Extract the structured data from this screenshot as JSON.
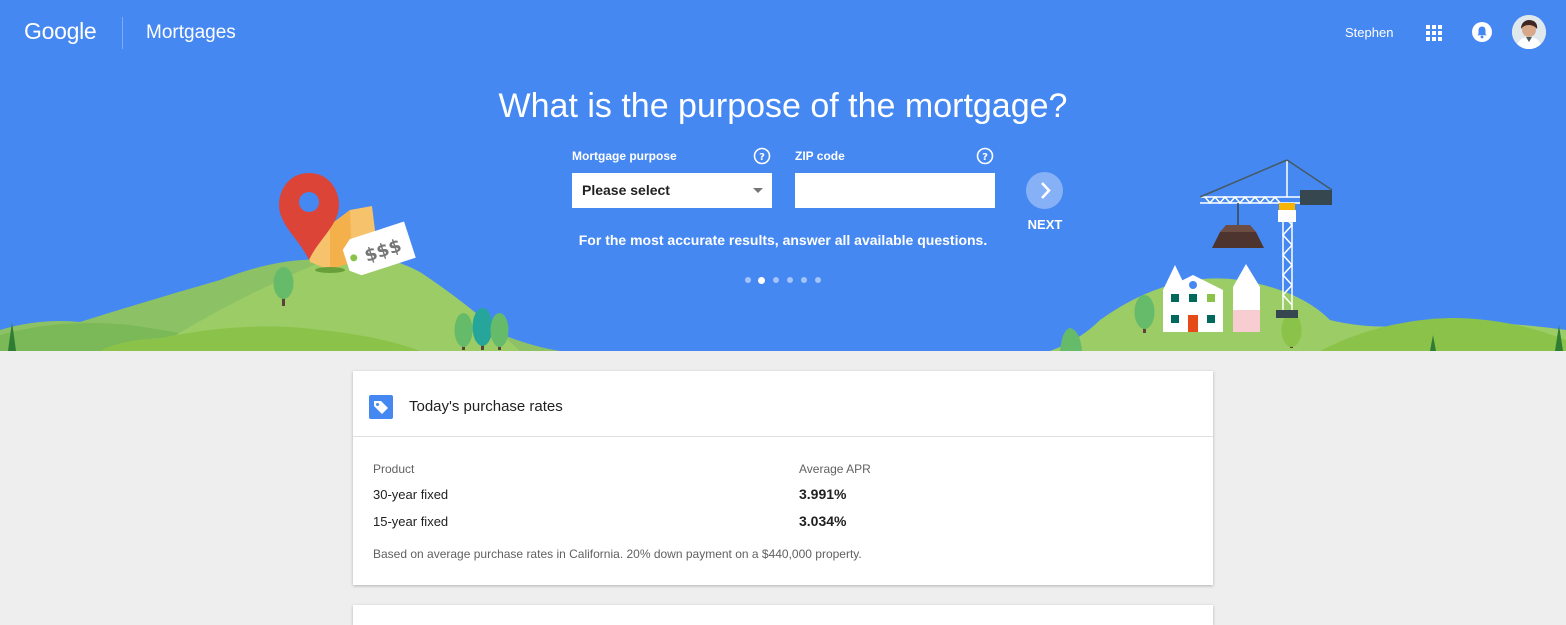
{
  "header": {
    "logo_text": "Google",
    "product_name": "Mortgages",
    "user_name": "Stephen",
    "icons": [
      "apps-icon",
      "notifications-bell-icon",
      "avatar"
    ]
  },
  "hero": {
    "headline": "What is the purpose of the mortgage?",
    "purpose_label": "Mortgage purpose",
    "purpose_value": "Please select",
    "zip_label": "ZIP code",
    "zip_value": "",
    "next_label": "NEXT",
    "hint": "For the most accurate results, answer all available questions.",
    "steps_total": 6,
    "steps_active": 2,
    "illustration_tag_text": "$$$",
    "background_color": "#4688f1"
  },
  "rates_card": {
    "title": "Today's purchase rates",
    "columns": [
      "Product",
      "Average APR"
    ],
    "rows": [
      {
        "product": "30-year fixed",
        "apr": "3.991%"
      },
      {
        "product": "15-year fixed",
        "apr": "3.034%"
      }
    ],
    "footnote": "Based on average purchase rates in California. 20% down payment on a $440,000 property."
  }
}
